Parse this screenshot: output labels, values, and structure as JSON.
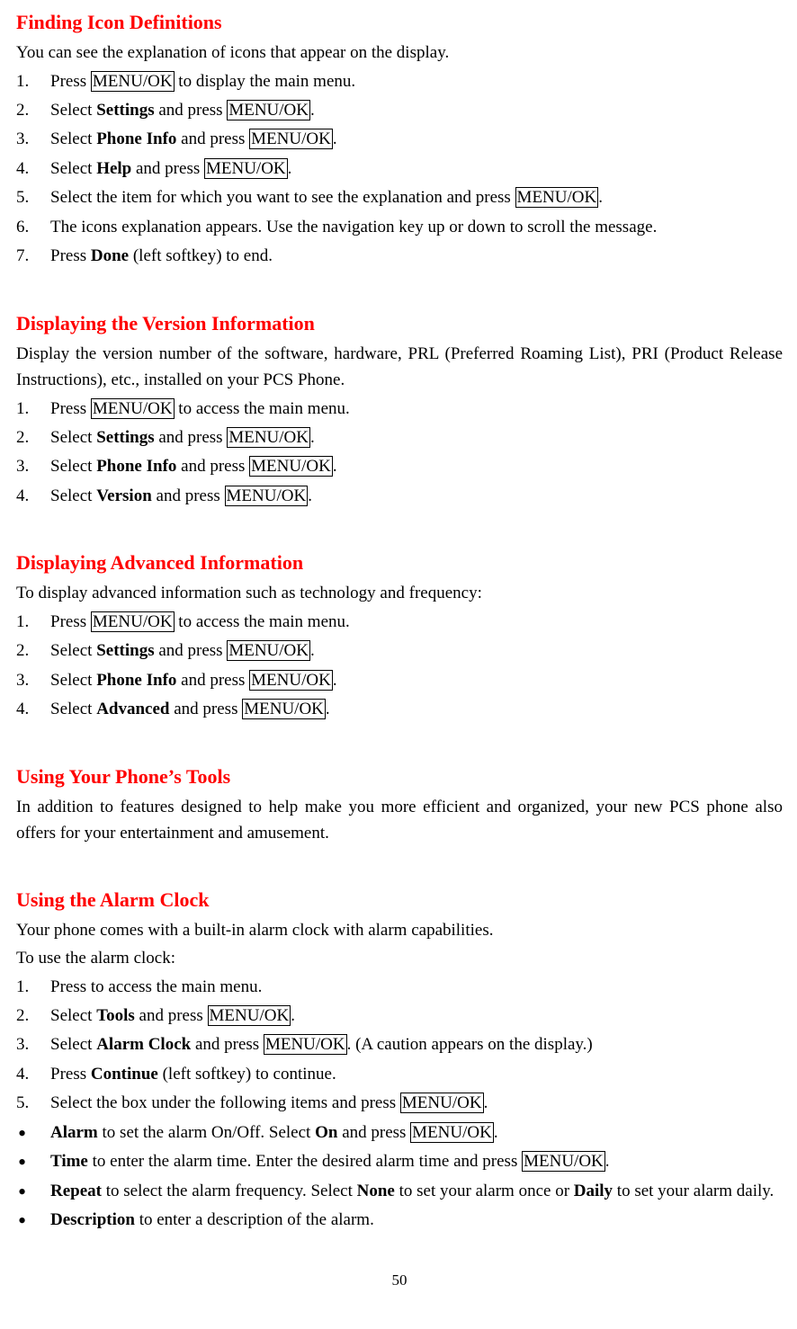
{
  "keys": {
    "menuok": "MENU/OK"
  },
  "s1": {
    "heading": "Finding Icon Definitions",
    "intro": "You can see the explanation of icons that appear on the display.",
    "steps": {
      "i1a": "Press ",
      "i1b": " to display the main menu.",
      "i2a": "Select ",
      "i2b": "Settings",
      "i2c": " and press ",
      "i3a": "Select ",
      "i3b": "Phone Info",
      "i3c": " and press ",
      "i4a": "Select ",
      "i4b": "Help",
      "i4c": " and press ",
      "i5a": "Select the item for which you want to see the explanation and press ",
      "i6": "The icons explanation appears. Use the navigation key up or down to scroll the message.",
      "i7a": "Press ",
      "i7b": "Done",
      "i7c": " (left softkey) to end."
    }
  },
  "s2": {
    "heading": "Displaying the Version Information",
    "intro": "Display the version number of the software, hardware, PRL (Preferred Roaming List), PRI (Product Release Instructions), etc., installed on your PCS Phone.",
    "steps": {
      "i1a": "Press ",
      "i1b": " to access the main menu.",
      "i2a": "Select ",
      "i2b": "Settings",
      "i2c": " and press ",
      "i3a": "Select ",
      "i3b": "Phone Info",
      "i3c": " and press ",
      "i4a": "Select ",
      "i4b": "Version",
      "i4c": " and press "
    }
  },
  "s3": {
    "heading": "Displaying Advanced Information",
    "intro": "To display advanced information such as technology and frequency:",
    "steps": {
      "i1a": "Press ",
      "i1b": " to access the main menu.",
      "i2a": "Select ",
      "i2b": "Settings",
      "i2c": " and press ",
      "i3a": "Select ",
      "i3b": "Phone Info",
      "i3c": " and press ",
      "i4a": "Select ",
      "i4b": "Advanced",
      "i4c": " and press "
    }
  },
  "s4": {
    "heading": "Using Your Phone’s Tools",
    "intro": "In addition to features designed to help make you more efficient and organized, your new PCS phone also offers for your entertainment and amusement."
  },
  "s5": {
    "heading": "Using the Alarm Clock",
    "intro1": "Your phone comes with a built-in alarm clock with alarm capabilities.",
    "intro2": "To use the alarm clock:",
    "steps": {
      "i1": "Press to access the main menu.",
      "i2a": "Select ",
      "i2b": "Tools",
      "i2c": " and press ",
      "i3a": "Select ",
      "i3b": "Alarm Clock",
      "i3c": " and press ",
      "i3d": ". (A caution appears on the display.)",
      "i4a": "Press ",
      "i4b": "Continue",
      "i4c": " (left softkey) to continue.",
      "i5a": "Select the box under the following items and press "
    },
    "bullets": {
      "b1a": "Alarm",
      "b1b": " to set the alarm On/Off. Select ",
      "b1c": "On",
      "b1d": " and press ",
      "b2a": "Time",
      "b2b": " to enter the alarm time. Enter the desired alarm time and press ",
      "b3a": "Repeat",
      "b3b": " to select the alarm frequency. Select ",
      "b3c": "None",
      "b3d": " to set your alarm once or ",
      "b3e": "Daily",
      "b3f": " to set your alarm daily.",
      "b4a": "Description",
      "b4b": " to enter a description of the alarm."
    }
  },
  "page": "50"
}
